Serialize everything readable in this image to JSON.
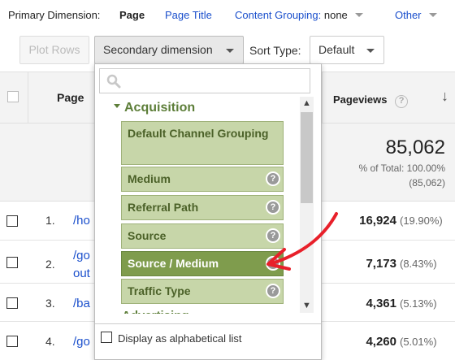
{
  "primary_dimension": {
    "label": "Primary Dimension:",
    "active": "Page",
    "links": [
      {
        "label": "Page Title"
      },
      {
        "label": "Content Grouping:",
        "value": "none"
      },
      {
        "label": "Other"
      }
    ]
  },
  "toolbar": {
    "plot_rows": "Plot Rows",
    "secondary_dimension": "Secondary dimension",
    "sort_type_label": "Sort Type:",
    "sort_type_value": "Default"
  },
  "table": {
    "headers": {
      "page": "Page",
      "pageviews": "Pageviews",
      "help": "?",
      "sort_arrow": "↓"
    },
    "totals": {
      "pageviews": "85,062",
      "pct_label": "% of Total: 100.00%",
      "total": "(85,062)"
    },
    "rows": [
      {
        "index": "1.",
        "page": "/ho",
        "pageviews": "16,924",
        "pct": "(19.90%)"
      },
      {
        "index": "2.",
        "page": "/go",
        "page_line2": "out",
        "pageviews": "7,173",
        "pct": "(8.43%)"
      },
      {
        "index": "3.",
        "page": "/ba",
        "pageviews": "4,361",
        "pct": "(5.13%)"
      },
      {
        "index": "4.",
        "page": "/go",
        "pageviews": "4,260",
        "pct": "(5.01%)"
      }
    ]
  },
  "dropdown": {
    "search_placeholder": "",
    "group": "Acquisition",
    "next_group": "Advertising",
    "items": [
      {
        "label": "Default Channel Grouping",
        "help": false
      },
      {
        "label": "Medium",
        "help": true
      },
      {
        "label": "Referral Path",
        "help": true
      },
      {
        "label": "Source",
        "help": true
      },
      {
        "label": "Source / Medium",
        "help": true,
        "selected": true
      },
      {
        "label": "Traffic Type",
        "help": true
      }
    ],
    "help_glyph": "?",
    "scroll_up": "▲",
    "scroll_down": "▼",
    "footer_label": "Display as alphabetical list"
  },
  "colors": {
    "link": "#1a4fcc",
    "group": "#5d7e39",
    "item_bg": "#c7d6a9",
    "item_selected_bg": "#7f9c4d",
    "annotation_arrow": "#e8202a"
  },
  "icons": [
    "search-icon",
    "help-icon",
    "sort-arrow-icon",
    "chevron-down-icon",
    "annotation-arrow-icon"
  ]
}
